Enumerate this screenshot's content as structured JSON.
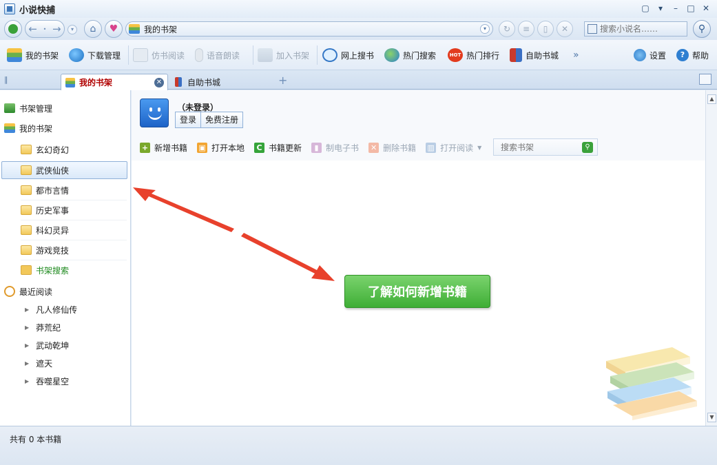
{
  "app": {
    "title": "小说快捕"
  },
  "address": {
    "text": "我的书架"
  },
  "search": {
    "placeholder": "搜索小说名……"
  },
  "toolbar": {
    "items": [
      {
        "label": "我的书架"
      },
      {
        "label": "下载管理"
      },
      {
        "label": "仿书阅读"
      },
      {
        "label": "语音朗读"
      },
      {
        "label": "加入书架"
      },
      {
        "label": "网上搜书"
      },
      {
        "label": "热门搜索"
      },
      {
        "label": "热门排行"
      },
      {
        "label": "自助书城"
      },
      {
        "label": "设置"
      },
      {
        "label": "帮助"
      }
    ],
    "hot_badge": "HOT",
    "more": "»"
  },
  "tabs": [
    {
      "label": "我的书架"
    },
    {
      "label": "自助书城"
    }
  ],
  "sidebar": {
    "manage": "书架管理",
    "shelf": "我的书架",
    "folders": [
      "玄幻奇幻",
      "武侠仙侠",
      "都市言情",
      "历史军事",
      "科幻灵异",
      "游戏竞技"
    ],
    "shelf_search": "书架搜索",
    "recent": "最近阅读",
    "recent_items": [
      "凡人修仙传",
      "莽荒纪",
      "武动乾坤",
      "遮天",
      "吞噬星空"
    ]
  },
  "user": {
    "status": "（未登录）",
    "login": "登录",
    "register": "免费注册"
  },
  "actions": [
    {
      "label": "新增书籍"
    },
    {
      "label": "打开本地"
    },
    {
      "label": "书籍更新"
    },
    {
      "label": "制电子书"
    },
    {
      "label": "删除书籍"
    },
    {
      "label": "打开阅读"
    }
  ],
  "shelf_search": {
    "placeholder": "搜索书架"
  },
  "guide": {
    "label": "了解如何新增书籍"
  },
  "statusbar": {
    "count": "共有 0 本书籍"
  },
  "colors": {
    "accent_red": "#e8412c",
    "guide_green": "#4cbc40",
    "tab_active_text": "#b00000"
  }
}
